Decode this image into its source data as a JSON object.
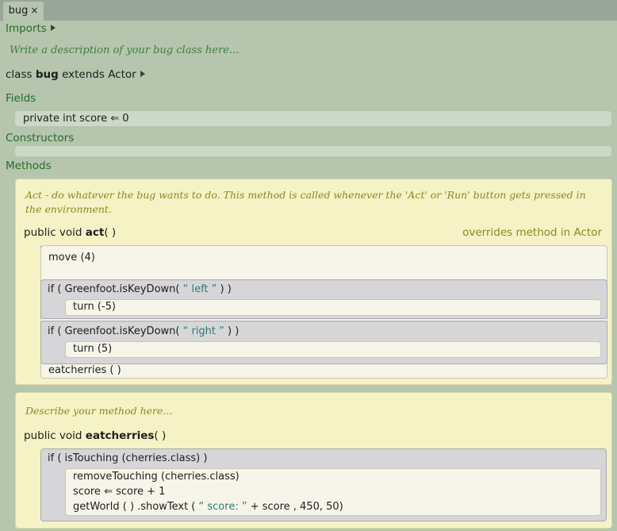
{
  "tab": {
    "label": "bug",
    "close_glyph": "×"
  },
  "imports": {
    "label": "Imports"
  },
  "class_description": "Write a description of your bug class here...",
  "class_decl": {
    "kw_class": "class",
    "name": "bug",
    "kw_extends": "extends",
    "parent": "Actor"
  },
  "fields": {
    "label": "Fields",
    "items": [
      {
        "text": "private  int score ⇐ 0"
      }
    ]
  },
  "constructors": {
    "label": "Constructors"
  },
  "methods": {
    "label": "Methods",
    "act": {
      "description": "Act - do whatever the bug wants to do. This method is called whenever the 'Act' or 'Run' button gets pressed in the environment.",
      "modifier": "public",
      "type": "void",
      "name": "act",
      "params": "( )",
      "override_note": "overrides  method  in  Actor",
      "stmt_move": "move (4)",
      "if1_head_pre": "if ( Greenfoot.isKeyDown(",
      "if1_str": "“ left ”",
      "if1_head_post": ") )",
      "if1_body": "turn (-5)",
      "if2_head_pre": "if ( Greenfoot.isKeyDown(",
      "if2_str": "“ right ”",
      "if2_head_post": ") )",
      "if2_body": "turn (5)",
      "stmt_eat": "eatcherries ( )"
    },
    "eatcherries": {
      "description": "Describe your method here...",
      "modifier": "public",
      "type": "void",
      "name": "eatcherries",
      "params": "( )",
      "if_head": "if ( isTouching (cherries.class) )",
      "line1": "removeTouching (cherries.class)",
      "line2": "score ⇐ score + 1",
      "line3_pre": "getWorld ( ) .showText (",
      "line3_str": "“ score: ”",
      "line3_post": "+ score , 450, 50)"
    }
  }
}
